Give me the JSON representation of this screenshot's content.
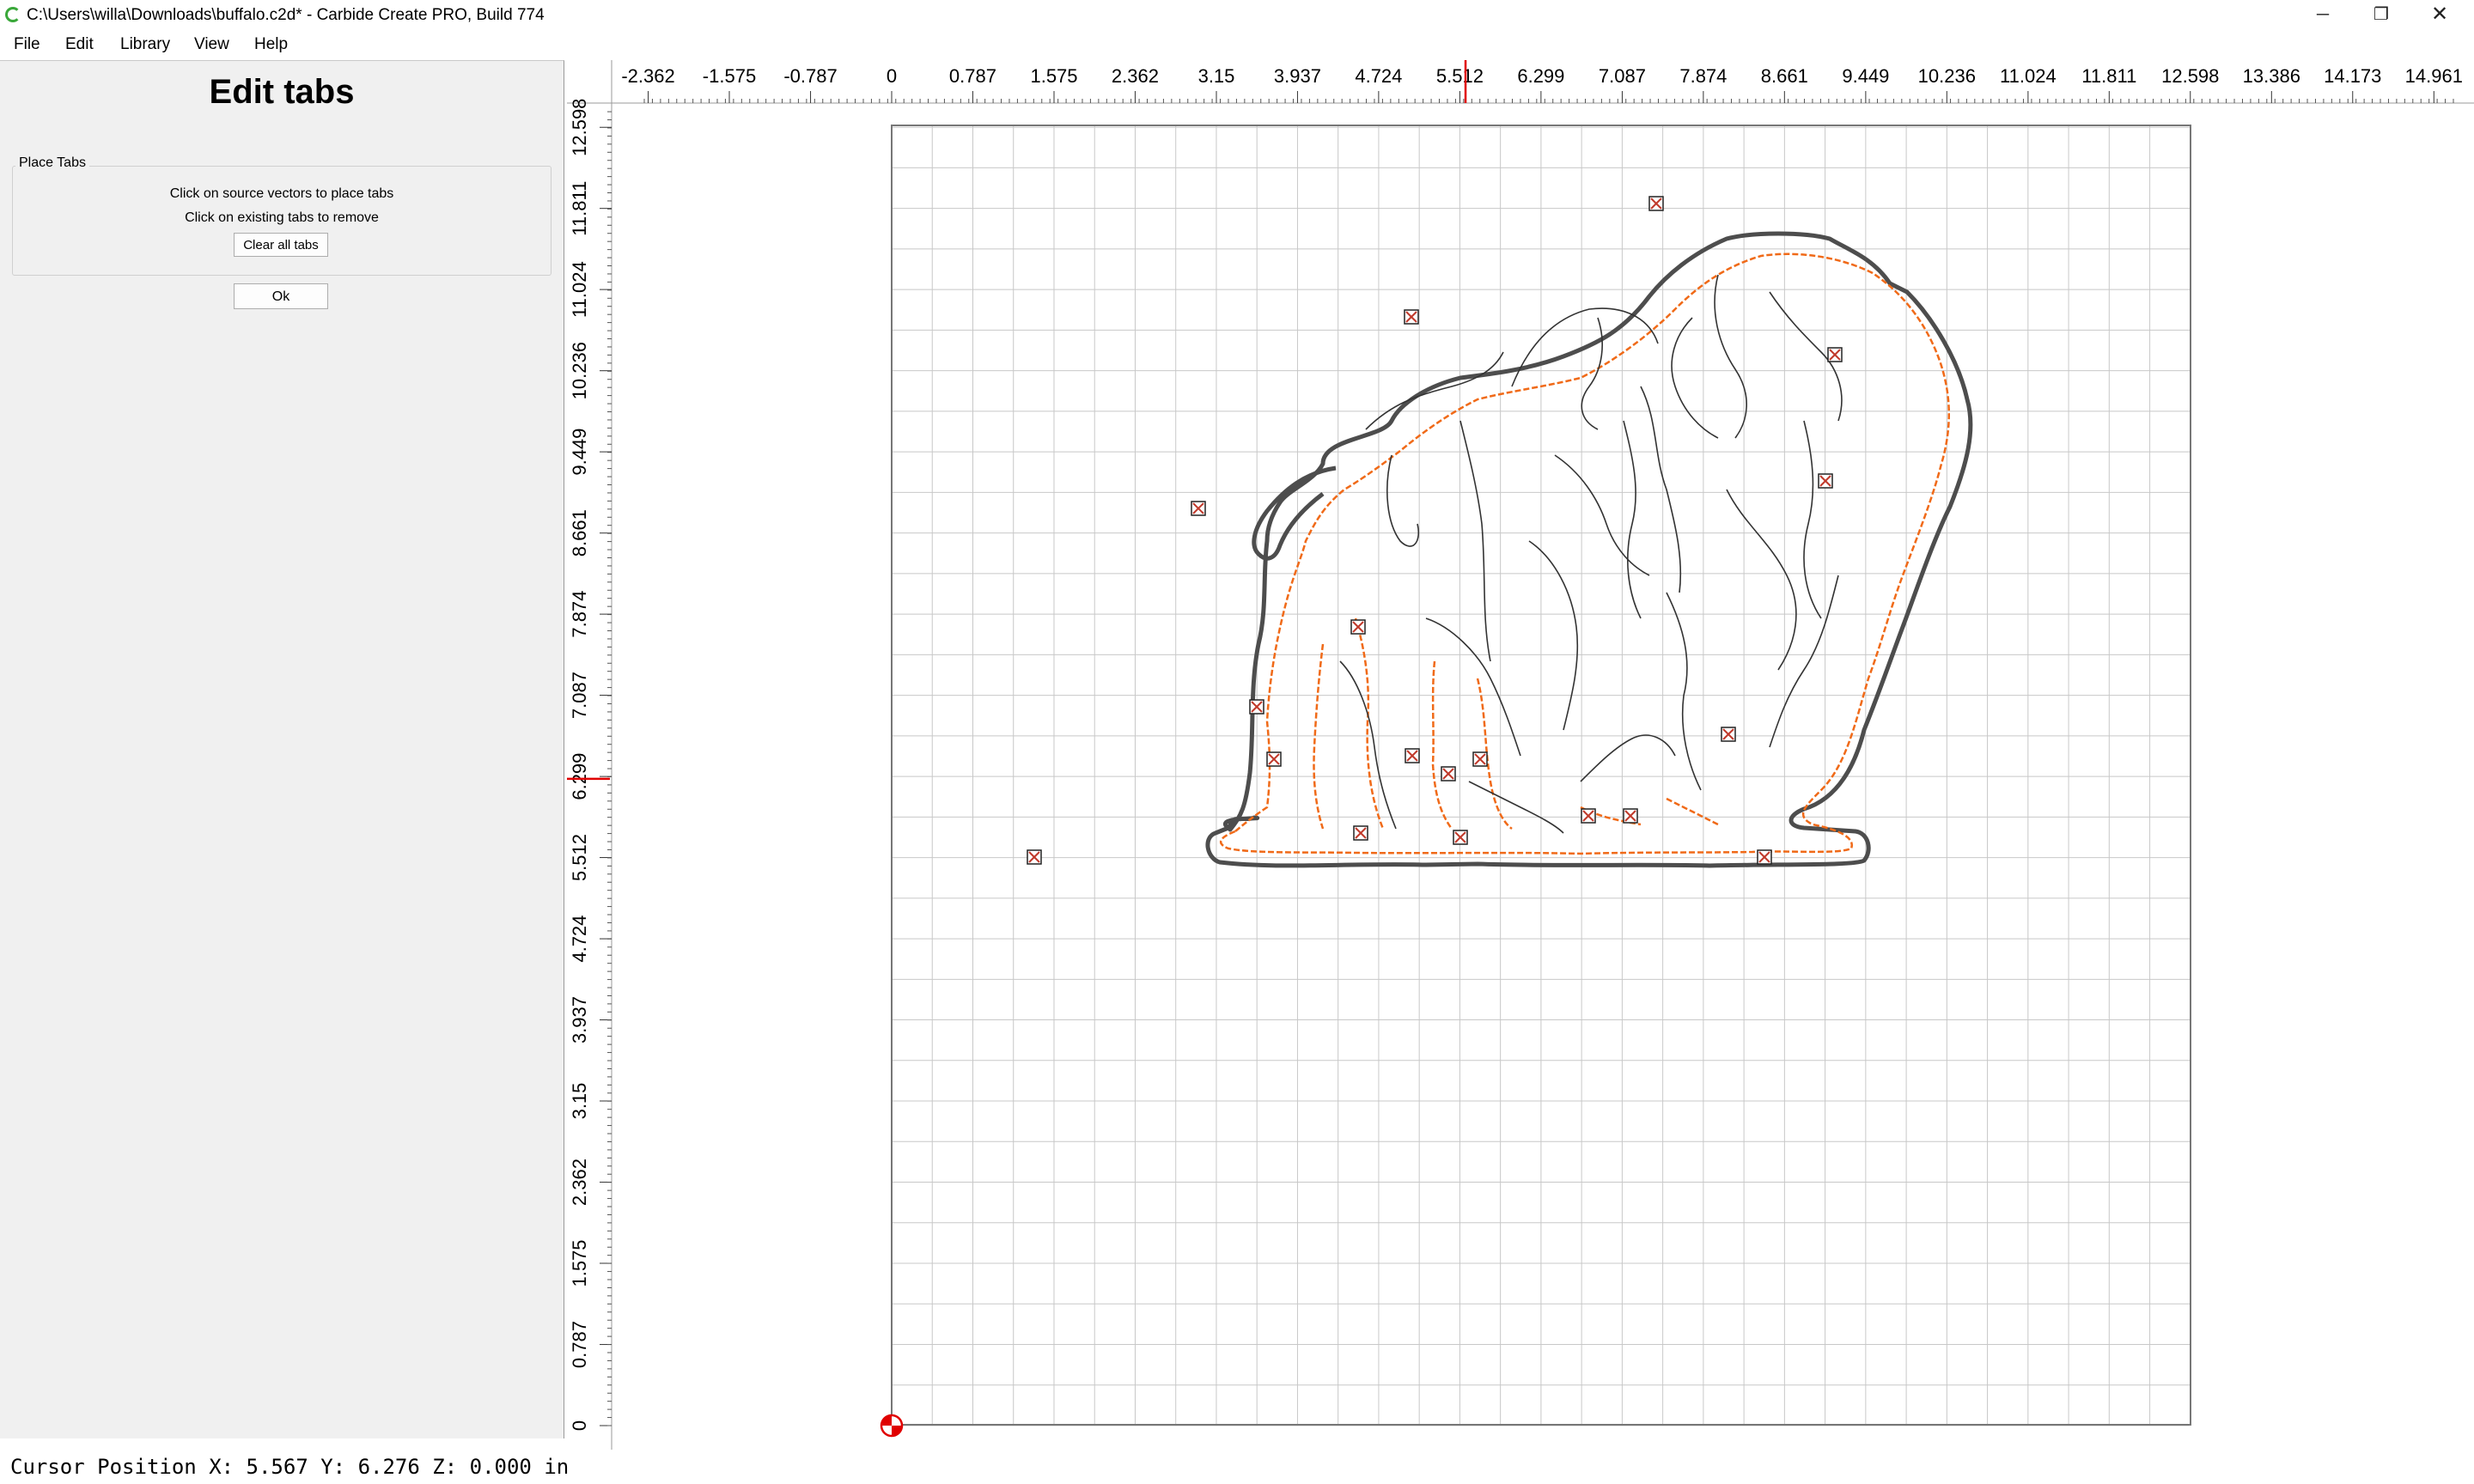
{
  "window": {
    "title": "C:\\Users\\willa\\Downloads\\buffalo.c2d* - Carbide Create PRO, Build 774",
    "minimize_glyph": "─",
    "maximize_glyph": "❐",
    "close_glyph": "✕"
  },
  "menu": [
    "File",
    "Edit",
    "Library",
    "View",
    "Help"
  ],
  "panel": {
    "title": "Edit tabs",
    "group_title": "Place Tabs",
    "instruction1": "Click on source vectors to place tabs",
    "instruction2": "Click on existing tabs to remove",
    "clear_button": "Clear all tabs",
    "ok_button": "Ok"
  },
  "rulers": {
    "unit": "in",
    "horizontal_labels": [
      "-2.362",
      "-1.575",
      "-0.787",
      "0",
      "0.787",
      "1.575",
      "2.362",
      "3.15",
      "3.937",
      "4.724",
      "5.512",
      "6.299",
      "7.087",
      "7.874",
      "8.661",
      "9.449",
      "10.236",
      "11.024",
      "11.811",
      "12.598",
      "13.386",
      "14.173",
      "14.961"
    ],
    "vertical_labels": [
      "12.598",
      "11.811",
      "11.024",
      "10.236",
      "9.449",
      "8.661",
      "7.874",
      "7.087",
      "6.299",
      "5.512",
      "4.724",
      "3.937",
      "3.15",
      "2.362",
      "1.575",
      "0.787",
      "0"
    ],
    "cursor_marker_x": 5.567,
    "cursor_marker_y": 6.276
  },
  "stock": {
    "width_in": 12.598,
    "height_in": 12.598,
    "grid_step_in": 0.3937
  },
  "colors": {
    "toolpath": "#f06a18",
    "outer_contour": "#4d4d4d",
    "artwork": "#333333",
    "tab": "#c0392b",
    "grid": "#c8c8c8",
    "ruler_marker": "#e00000"
  },
  "tabs_count": 18,
  "status": {
    "cursor_position": "Cursor Position X: 5.567 Y: 6.276 Z: 0.000 in"
  }
}
